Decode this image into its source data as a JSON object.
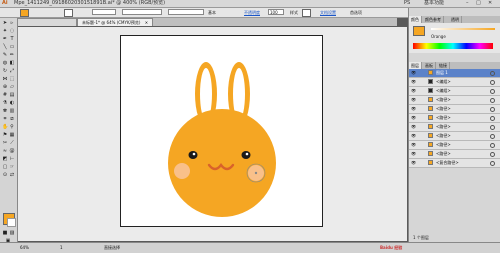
{
  "titlebar": {
    "logo": "Ai",
    "tab_file": "Mpe_1411249_0918602030151891B.ai* @ 400% (RGB/预览)",
    "ps_label": "PS",
    "essentials_label": "基本功能"
  },
  "control_bar": {
    "fill_color": "#f5a623",
    "stroke_label": "描边",
    "stroke_value": "",
    "brush_label": "基本",
    "opacity_label": "不透明度",
    "opacity_value": "100",
    "style_label": "样式",
    "doc_setup_label": "文档设置",
    "prefs_label": "首选项"
  },
  "doc_tab": {
    "label": "未标题-1* @ 64% (CMYK/预览)"
  },
  "tools": {
    "icons": [
      "selection-icon",
      "direct-selection-icon",
      "magic-wand-icon",
      "lasso-icon",
      "pen-icon",
      "type-icon",
      "line-icon",
      "rectangle-icon",
      "paintbrush-icon",
      "pencil-icon",
      "blob-brush-icon",
      "eraser-icon",
      "rotate-icon",
      "scale-icon",
      "width-icon",
      "free-transform-icon",
      "shape-builder-icon",
      "perspective-icon",
      "mesh-icon",
      "gradient-icon",
      "eyedropper-icon",
      "blend-icon",
      "symbol-sprayer-icon",
      "column-graph-icon",
      "artboard-icon",
      "slice-icon",
      "hand-icon",
      "zoom-icon"
    ],
    "fill_swatch_color": "#f5a623"
  },
  "color_panel": {
    "tabs": [
      "颜色",
      "颜色参考",
      "透明"
    ],
    "color_name": "Orange",
    "color_value": "#f5a623"
  },
  "layers_panel": {
    "tabs": [
      "图层",
      "画板",
      "链接"
    ],
    "rows": [
      {
        "name": "图层 1",
        "selected": true
      },
      {
        "name": "<编组>",
        "selected": false
      },
      {
        "name": "<编组>",
        "selected": false
      },
      {
        "name": "<路径>",
        "selected": false
      },
      {
        "name": "<路径>",
        "selected": false
      },
      {
        "name": "<路径>",
        "selected": false
      },
      {
        "name": "<路径>",
        "selected": false
      },
      {
        "name": "<路径>",
        "selected": false
      },
      {
        "name": "<路径>",
        "selected": false
      },
      {
        "name": "<路径>",
        "selected": false
      },
      {
        "name": "<复合路径>",
        "selected": false
      }
    ],
    "footer": "1 个图层"
  },
  "status_bar": {
    "zoom": "64%",
    "page": "1",
    "tool_name": "直接选择"
  },
  "watermark": "Baidu 经验",
  "artwork": {
    "face_color": "#f5a623",
    "ear_color": "#f5a623",
    "eye_color": "#1a1a1a",
    "cheek_color": "#f9c08a",
    "mouth_color": "#d9632a"
  }
}
